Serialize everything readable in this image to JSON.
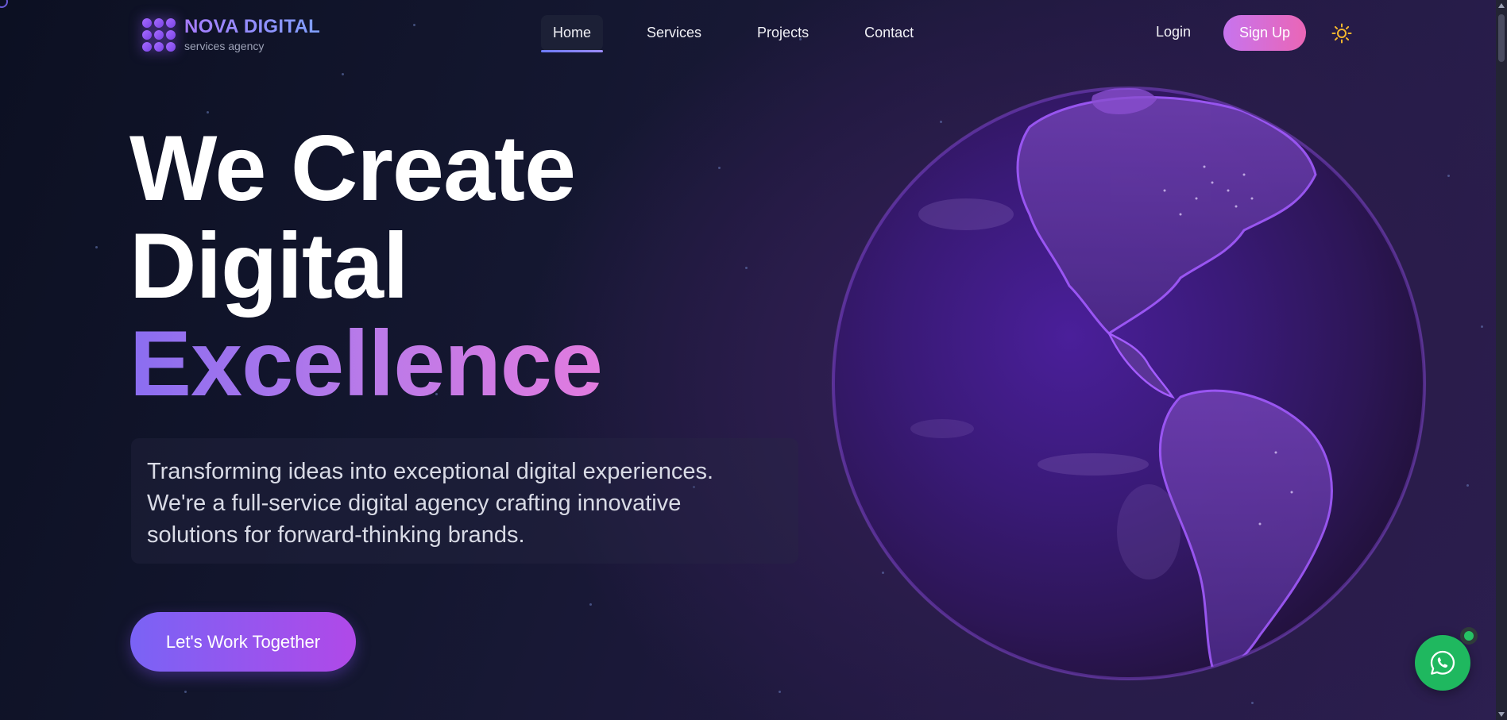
{
  "brand": {
    "name": "NOVA DIGITAL",
    "tagline": "services agency",
    "icon": "dots-grid-logo-icon"
  },
  "nav": {
    "links": [
      {
        "label": "Home",
        "active": true
      },
      {
        "label": "Services",
        "active": false
      },
      {
        "label": "Projects",
        "active": false
      },
      {
        "label": "Contact",
        "active": false
      }
    ],
    "login_label": "Login",
    "signup_label": "Sign Up",
    "theme_toggle_icon": "sun-icon"
  },
  "hero": {
    "line1": "We Create",
    "line2": "Digital",
    "line3": "Excellence",
    "description": "Transforming ideas into exceptional digital experiences. We're a full-service digital agency crafting innovative solutions for forward-thinking brands.",
    "cta_label": "Let's Work Together",
    "visual": "earth-globe-image"
  },
  "floating": {
    "icon": "whatsapp-icon",
    "status": "online"
  },
  "colors": {
    "accent": "#8a6df0",
    "accent_pink": "#e27bdf",
    "signup_start": "#c774ee",
    "signup_end": "#ea66b6",
    "whatsapp": "#1fb85f",
    "sun": "#f5b72e"
  }
}
